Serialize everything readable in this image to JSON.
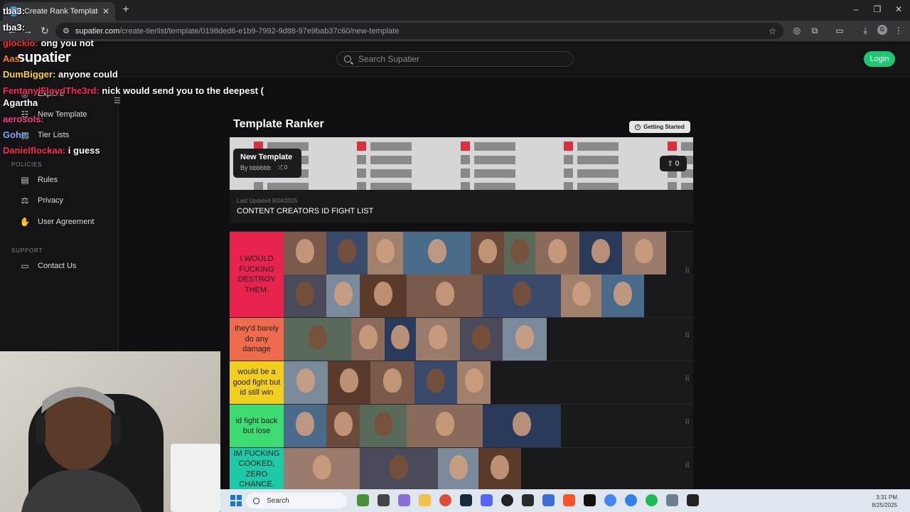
{
  "browser": {
    "tab_title": "Create Rank Template",
    "url_host": "supatier.com",
    "url_path": "/create-tierlist/template/0198ded6-e1b9-7992-9d88-97e9bab37c60/new-template",
    "new_tab_symbol": "+",
    "close_symbol": "✕"
  },
  "header": {
    "brand": "supatier",
    "search_placeholder": "Search Supatier",
    "login_label": "Login"
  },
  "sidebar": {
    "main_items": [
      {
        "label": "Explore",
        "icon": "compass-icon"
      },
      {
        "label": "New Template",
        "icon": "plus-list-icon"
      },
      {
        "label": "Tier Lists",
        "icon": "grid-icon"
      }
    ],
    "policies_heading": "POLICIES",
    "policies": [
      {
        "label": "Rules",
        "icon": "rules-icon"
      },
      {
        "label": "Privacy",
        "icon": "scale-icon"
      },
      {
        "label": "User Agreement",
        "icon": "handshake-icon"
      }
    ],
    "support_heading": "SUPPORT",
    "support": [
      {
        "label": "Contact Us",
        "icon": "message-icon"
      }
    ]
  },
  "main": {
    "page_title": "Template Ranker",
    "getting_started": "Getting Started",
    "card": {
      "title": "New Template",
      "by": "By bbbbbb",
      "count": "0"
    },
    "upvotes": "0",
    "last_updated": "Last Updated 8/24/2025",
    "description": "CONTENT CREATORS ID FIGHT LIST"
  },
  "tiers": [
    {
      "label": "I WOULD FUCKING DESTROY THEM.",
      "color": "#e8234d",
      "count": 18
    },
    {
      "label": "they'd barely do any damage",
      "color": "#ee6c4d",
      "count": 6
    },
    {
      "label": "would be a good fight but id still win",
      "color": "#f2cf1f",
      "count": 5
    },
    {
      "label": "id fight back but lose",
      "color": "#3ddc72",
      "count": 5
    },
    {
      "label": "IM FUCKING COOKED, ZERO CHANCE.",
      "color": "#1ec9a8",
      "count": 4
    }
  ],
  "chat": [
    {
      "user": "glockio:",
      "color": "#ff2a2a",
      "msg": "ong you not"
    },
    {
      "user": "Aas",
      "color": "#ff8a00",
      "msg": ""
    },
    {
      "user": "DumBigger:",
      "color": "#ffd23a",
      "msg": "anyone could"
    },
    {
      "user": "FentanylFloydThe3rd:",
      "color": "#ff2a55",
      "msg": "nick would send you to the deepest ("
    },
    {
      "user": "Agartha",
      "color": "#ffffff",
      "msg": ""
    },
    {
      "user": "aerosols:",
      "color": "#ff3b8d",
      "msg": ""
    },
    {
      "user": "Gohe:",
      "color": "#7fb5ff",
      "msg": ""
    },
    {
      "user": "Danielflockaa:",
      "color": "#ff2a55",
      "msg": "i guess"
    }
  ],
  "tba": [
    "tba3:",
    "tba3:"
  ],
  "taskbar": {
    "search_label": "Search",
    "time": "3:31 PM",
    "date": "8/25/2025"
  }
}
